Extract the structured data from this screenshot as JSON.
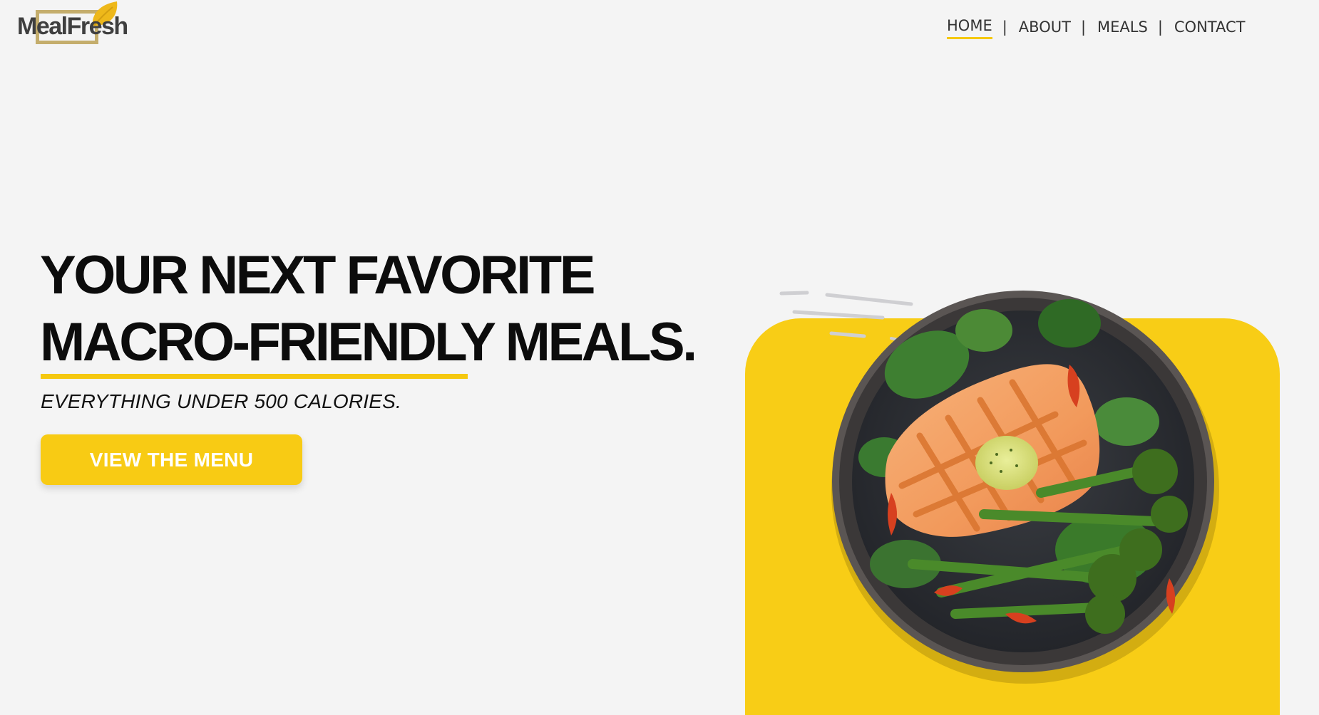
{
  "brand": {
    "name": "MealFresh",
    "colors": {
      "accent": "#f8cb14",
      "frame": "#c4ad6c",
      "background": "#f4f4f4",
      "text": "#111111"
    }
  },
  "nav": {
    "items": [
      {
        "label": "HOME",
        "active": true
      },
      {
        "label": "ABOUT",
        "active": false
      },
      {
        "label": "MEALS",
        "active": false
      },
      {
        "label": "CONTACT",
        "active": false
      }
    ],
    "separator": "|"
  },
  "hero": {
    "headline_line1": "YOUR NEXT FAVORITE",
    "headline_line2": "MACRO-FRIENDLY MEALS.",
    "subtitle": "EVERYTHING UNDER 500 CALORIES.",
    "cta_label": "VIEW THE MENU",
    "image_icon": "salmon-plate-image"
  }
}
